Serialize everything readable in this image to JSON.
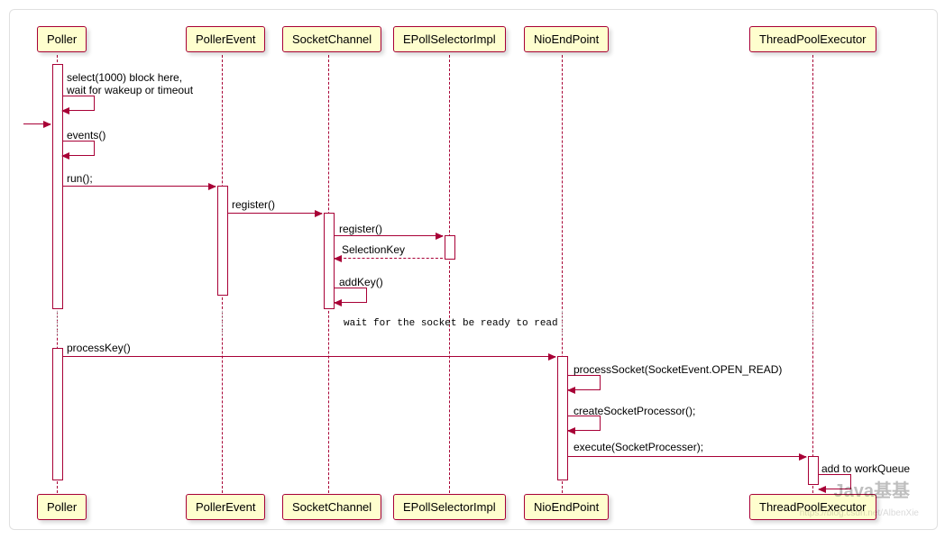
{
  "participants": {
    "poller": "Poller",
    "pollerEvent": "PollerEvent",
    "socketChannel": "SocketChannel",
    "epollSelectorImpl": "EPollSelectorImpl",
    "nioEndPoint": "NioEndPoint",
    "threadPoolExecutor": "ThreadPoolExecutor"
  },
  "messages": {
    "select": "select(1000) block here,\nwait for wakeup or timeout",
    "events": "events()",
    "run": "run();",
    "register1": "register()",
    "register2": "register()",
    "selectionKey": "SelectionKey",
    "addKey": "addKey()",
    "waitNote": "wait for the socket be ready to read",
    "processKey": "processKey()",
    "processSocket": "processSocket(SocketEvent.OPEN_READ)",
    "createSocketProcessor": "createSocketProcessor();",
    "execute": "execute(SocketProcesser);",
    "addToWorkQueue": "add to workQueue"
  },
  "watermark": "Java基基",
  "watermarkSub": "https://blog.csdn.net/AlbenXie"
}
